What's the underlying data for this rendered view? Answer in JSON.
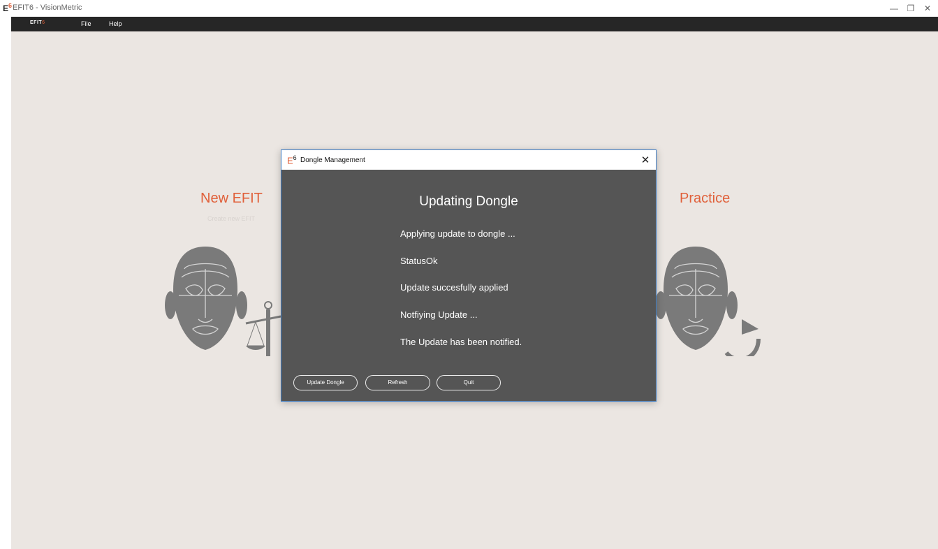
{
  "window": {
    "title": "EFIT6 - VisionMetric",
    "icon_letter": "E",
    "icon_sup": "6",
    "minimize_glyph": "—",
    "restore_glyph": "❐",
    "close_glyph": "✕"
  },
  "menubar": {
    "logo_main": "EFIT",
    "logo_sup": "6",
    "items": [
      "File",
      "Help"
    ]
  },
  "tiles": [
    {
      "title": "New EFIT",
      "subtitle": "Create new EFIT"
    },
    {
      "title": "Practice",
      "subtitle": ""
    }
  ],
  "dialog": {
    "icon_letter": "E",
    "icon_sup": "6",
    "title": "Dongle Management",
    "close_glyph": "✕",
    "heading": "Updating Dongle",
    "status_lines": [
      "Applying update to dongle ...",
      "StatusOk",
      "Update succesfully applied",
      "Notfiying Update ...",
      "The Update has been notified."
    ],
    "buttons": [
      "Update Dongle",
      "Refresh",
      "Quit"
    ]
  },
  "colors": {
    "accent": "#e0603a",
    "workspace_bg": "#ebe6e2",
    "dialog_bg": "#555555",
    "dialog_border": "#3f7dc4",
    "menubar_bg": "#262626"
  }
}
